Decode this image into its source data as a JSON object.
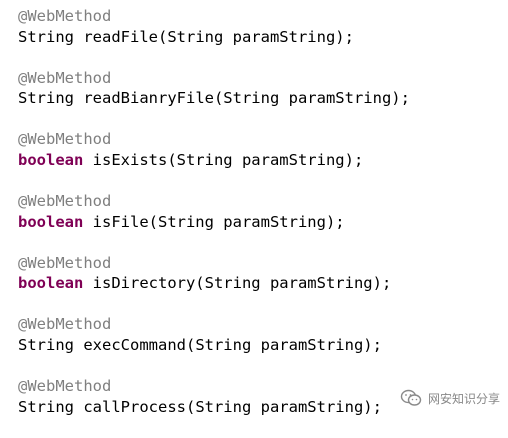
{
  "code": {
    "methods": [
      {
        "annotation": "@WebMethod",
        "return_type": "String",
        "return_is_keyword": false,
        "signature": " readFile(String paramString);"
      },
      {
        "annotation": "@WebMethod",
        "return_type": "String",
        "return_is_keyword": false,
        "signature": " readBianryFile(String paramString);"
      },
      {
        "annotation": "@WebMethod",
        "return_type": "boolean",
        "return_is_keyword": true,
        "signature": " isExists(String paramString);"
      },
      {
        "annotation": "@WebMethod",
        "return_type": "boolean",
        "return_is_keyword": true,
        "signature": " isFile(String paramString);"
      },
      {
        "annotation": "@WebMethod",
        "return_type": "boolean",
        "return_is_keyword": true,
        "signature": " isDirectory(String paramString);"
      },
      {
        "annotation": "@WebMethod",
        "return_type": "String",
        "return_is_keyword": false,
        "signature": " execCommand(String paramString);"
      },
      {
        "annotation": "@WebMethod",
        "return_type": "String",
        "return_is_keyword": false,
        "signature": " callProcess(String paramString);"
      }
    ]
  },
  "watermark": {
    "text": "网安知识分享",
    "icon": "wechat-icon"
  },
  "colors": {
    "annotation": "#7f7f7f",
    "keyword": "#7f0055",
    "text": "#000000"
  }
}
